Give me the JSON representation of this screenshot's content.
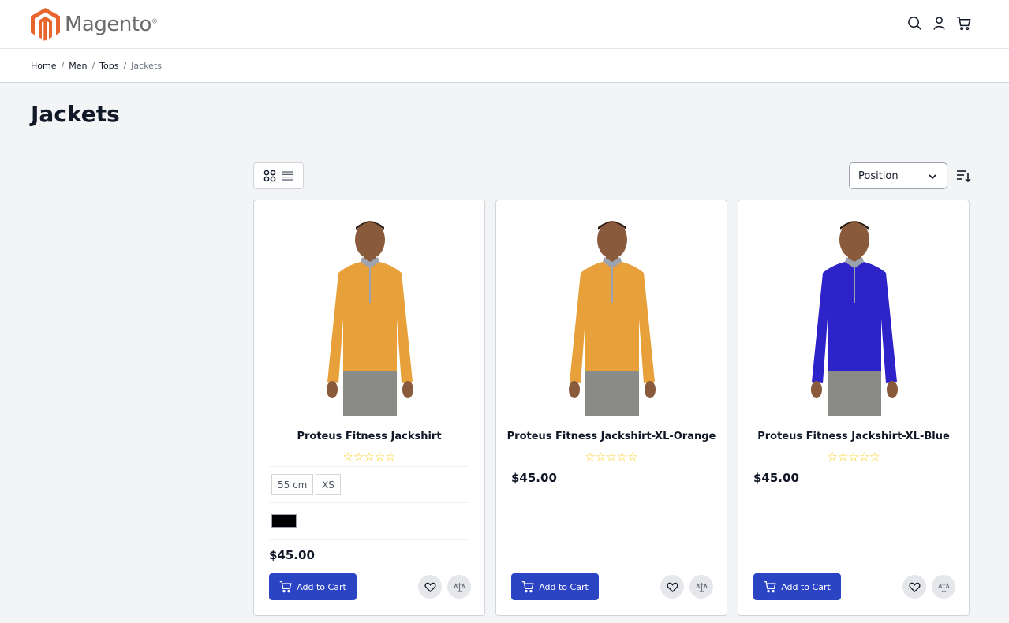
{
  "brand": {
    "name": "Magento",
    "logo_color": "#e8662e"
  },
  "header": {
    "icons": [
      "search-icon",
      "account-icon",
      "cart-icon"
    ]
  },
  "breadcrumbs": {
    "items": [
      "Home",
      "Men",
      "Tops"
    ],
    "current": "Jackets"
  },
  "page": {
    "title": "Jackets"
  },
  "toolbar": {
    "view_modes": [
      "grid-view-icon",
      "list-view-icon"
    ],
    "sort_label": "Position",
    "sort_direction_icon": "sort-descending-icon"
  },
  "products": [
    {
      "name": "Proteus Fitness Jackshirt",
      "rating": "☆☆☆☆☆",
      "sizes": [
        "55 cm",
        "XS"
      ],
      "color_swatch": "#000000",
      "price": "$45.00",
      "add_to_cart": "Add to Cart",
      "shirt_color": "#e8a13a"
    },
    {
      "name": "Proteus Fitness Jackshirt-XL-Orange",
      "rating": "☆☆☆☆☆",
      "price": "$45.00",
      "add_to_cart": "Add to Cart",
      "shirt_color": "#e8a13a"
    },
    {
      "name": "Proteus Fitness Jackshirt-XL-Blue",
      "rating": "☆☆☆☆☆",
      "price": "$45.00",
      "add_to_cart": "Add to Cart",
      "shirt_color": "#2e22c9"
    }
  ],
  "colors": {
    "primary_button": "#2b44c4",
    "star": "#facc15"
  }
}
